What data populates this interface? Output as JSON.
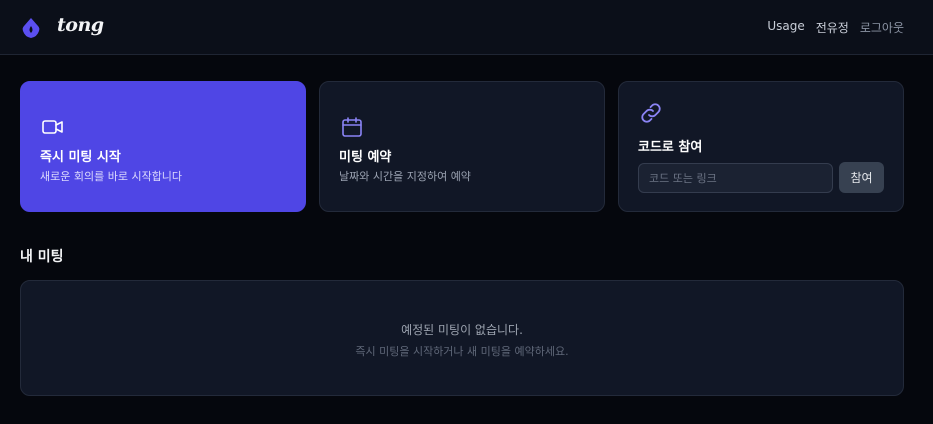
{
  "header": {
    "brand": "tong",
    "nav": [
      "Usage",
      "전유정",
      "로그아웃"
    ]
  },
  "cards": {
    "instant": {
      "icon": "video-camera-icon",
      "title": "즉시 미팅 시작",
      "desc": "새로운 회의를 바로 시작합니다"
    },
    "schedule": {
      "icon": "calendar-icon",
      "title": "미팅 예약",
      "desc": "날짜와 시간을 지정하여 예약"
    },
    "join": {
      "icon": "link-icon",
      "title": "코드로 참여",
      "placeholder": "코드 또는 링크",
      "button": "참여"
    }
  },
  "meetings": {
    "title": "내 미팅",
    "empty_title": "예정된 미팅이 없습니다.",
    "empty_sub": "즉시 미팅을 시작하거나 새 미팅을 예약하세요."
  },
  "colors": {
    "accent": "#4f46e5",
    "background": "#05070d",
    "card": "#111726"
  }
}
